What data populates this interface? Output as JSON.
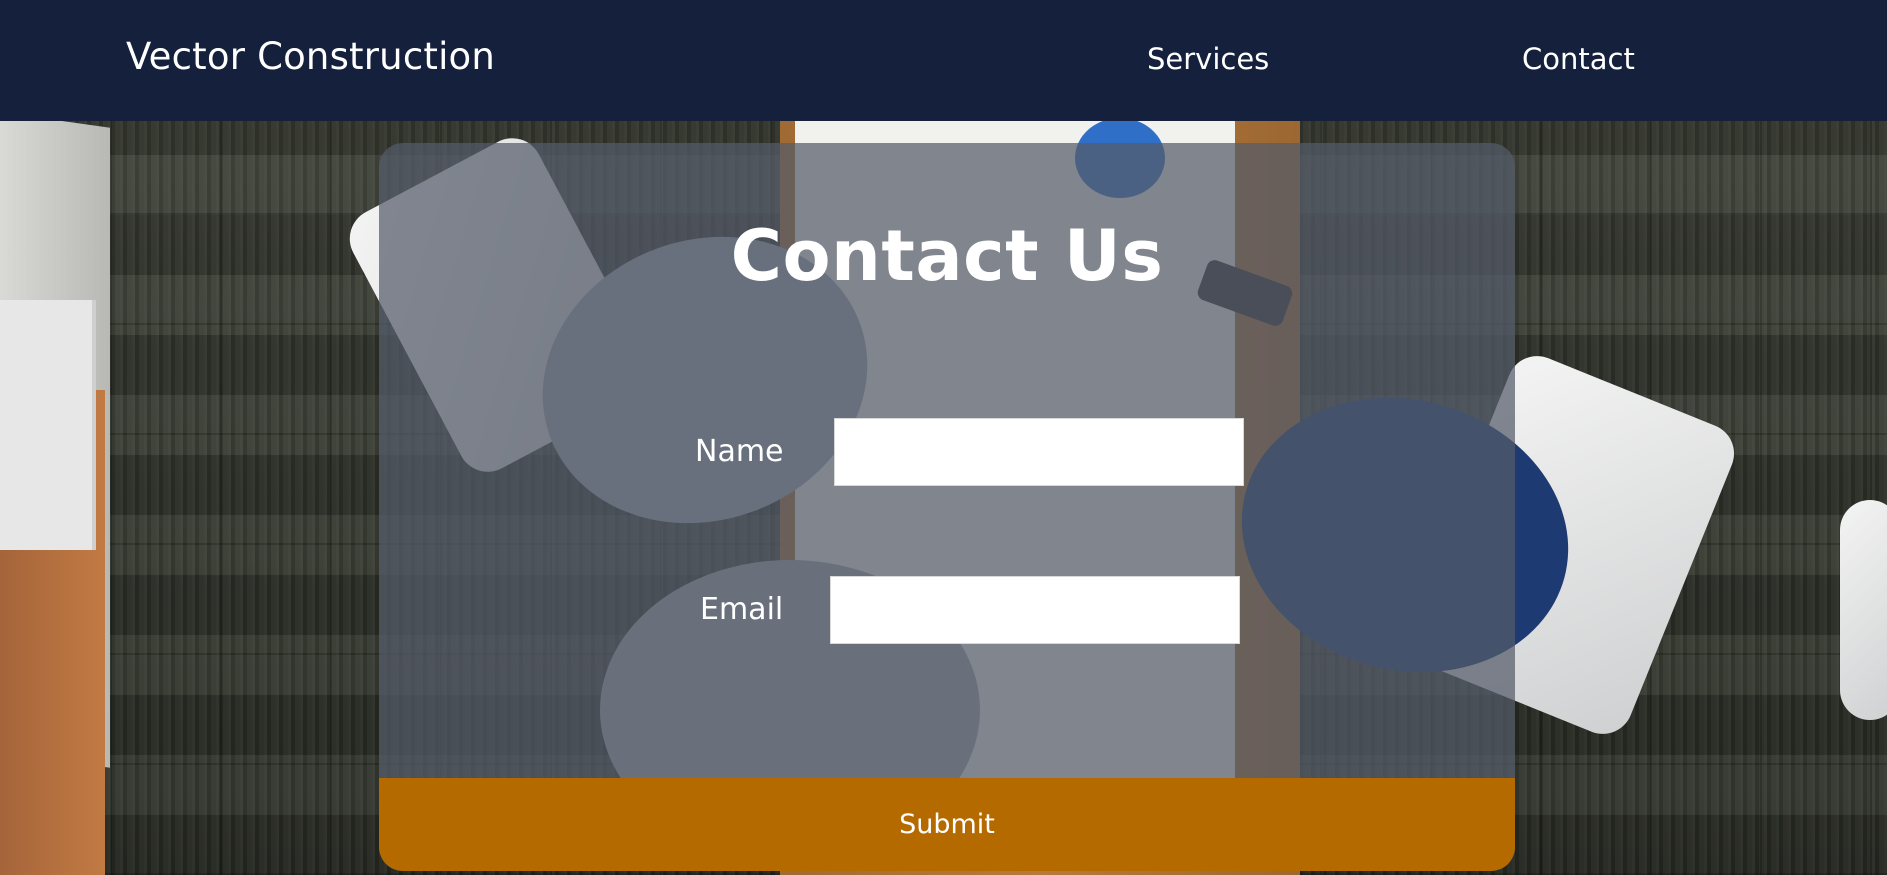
{
  "header": {
    "brand": "Vector Construction",
    "nav": {
      "services_label": "Services",
      "contact_label": "Contact"
    }
  },
  "contact_form": {
    "title": "Contact Us",
    "name_label": "Name",
    "name_value": "",
    "email_label": "Email",
    "email_value": "",
    "submit_label": "Submit"
  },
  "colors": {
    "navbar_background": "#14203c",
    "submit_button": "#b56a00",
    "card_overlay": "#545c69",
    "text": "#ffffff"
  }
}
